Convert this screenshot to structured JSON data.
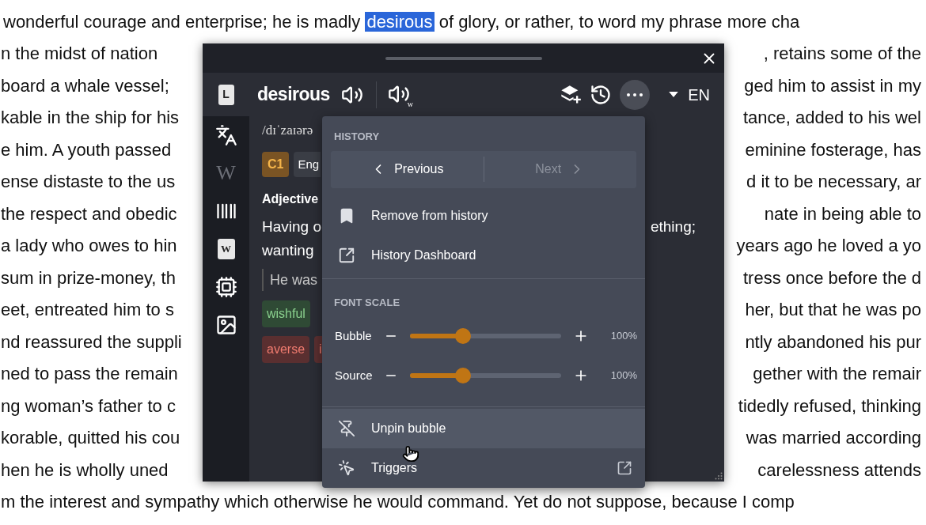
{
  "document": {
    "lines": [
      {
        "left": "wonderful courage and enterprise; he is madly",
        "highlight": "desirous",
        "right": "of glory, or rather, to word my phrase more cha"
      },
      {
        "left": "n the midst of nation",
        "right": ", retains some of the"
      },
      {
        "left": "board a whale vessel;",
        "right": "ged him to assist in my"
      },
      {
        "left": "kable in the ship for his",
        "right": "tance, added to his wel"
      },
      {
        "left": "e him. A youth passed",
        "right": "eminine fosterage, has"
      },
      {
        "left": "ense distaste to the us",
        "right": "d it to be necessary, ar"
      },
      {
        "left": "the respect and obedic",
        "right": "nate in being able to"
      },
      {
        "left": "a lady who owes to hin",
        "right": "years ago he loved a yo"
      },
      {
        "left": "sum in prize-money, th",
        "right": "tress once before the d"
      },
      {
        "left": "eet, entreated him to s",
        "right": "her, but that he was po"
      },
      {
        "left": "nd reassured the suppli",
        "right": "ntly abandoned his pur"
      },
      {
        "left": "ned to pass the remain",
        "right": "gether with the remair"
      },
      {
        "left": "ng woman’s father to c",
        "right": "tidedly refused, thinking"
      },
      {
        "left": "korable, quitted his cou",
        "right": "was married according"
      },
      {
        "left": "hen he is wholly uned",
        "right": "carelessness attends"
      },
      {
        "left": "m the interest and sympathy which otherwise he would command. Yet do not suppose, because I comp"
      }
    ]
  },
  "popup": {
    "header": {
      "logo_glyph": "L",
      "word": "desirous",
      "wiki_audio_glyph": "w",
      "more_expanded": true,
      "language": "EN"
    },
    "sidebar": [
      {
        "kind": "translate",
        "disabled": false
      },
      {
        "kind": "wiki",
        "glyph": "W",
        "disabled": true
      },
      {
        "kind": "barcode",
        "disabled": false
      },
      {
        "kind": "book",
        "glyph": "W",
        "disabled": false
      },
      {
        "kind": "chip",
        "disabled": false
      },
      {
        "kind": "image",
        "disabled": false
      }
    ],
    "content": {
      "pronunciation": "/dɪˈzaɪərə",
      "level": "C1",
      "language_chip": "Eng",
      "part_of_speech": "Adjective",
      "definition_left": "Having o",
      "definition_right": "ething;",
      "definition_line2": "wanting",
      "example": "He was",
      "synonyms": [
        "wishful"
      ],
      "antonyms": [
        "averse",
        "i"
      ]
    },
    "menu": {
      "history_heading": "HISTORY",
      "nav": [
        {
          "kind": "previous",
          "label": "Previous",
          "disabled": false
        },
        {
          "kind": "next",
          "label": "Next",
          "disabled": true
        }
      ],
      "history_items": [
        {
          "kind": "bookmark",
          "label": "Remove from history"
        },
        {
          "kind": "external",
          "label": "History Dashboard"
        }
      ],
      "font_heading": "FONT SCALE",
      "sliders": [
        {
          "label": "Bubble",
          "level": 0.35,
          "value": "100%"
        },
        {
          "label": "Source",
          "level": 0.35,
          "value": "100%"
        }
      ],
      "items": [
        {
          "kind": "unpin",
          "label": "Unpin bubble",
          "highlighted": true
        },
        {
          "kind": "triggers",
          "label": "Triggers",
          "highlighted": false
        }
      ]
    }
  }
}
